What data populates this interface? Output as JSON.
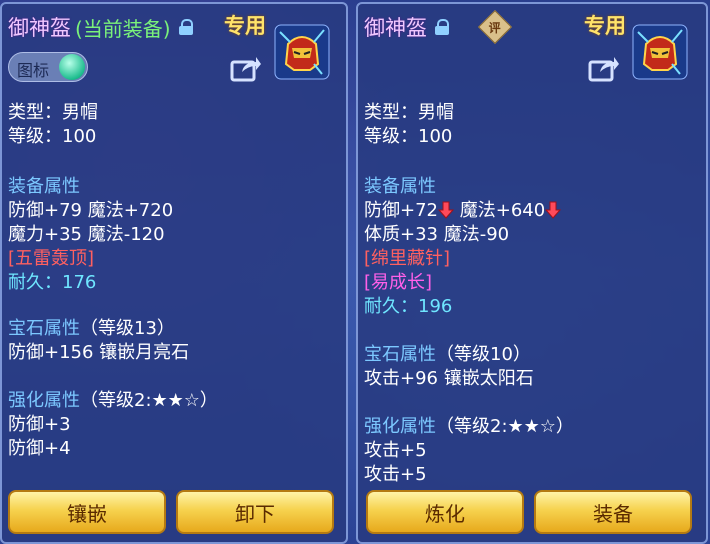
{
  "left": {
    "title": "御神盔",
    "equipped_tag": "(当前装备)",
    "exclusive": "专用",
    "toggle_label": "图标",
    "type": "类型：男帽",
    "level": "等级：100",
    "equip_section": "装备属性",
    "attr1": "防御+79 魔法+720",
    "attr2": "魔力+35 魔法-120",
    "special": "[五雷轰顶]",
    "durability": "耐久：176",
    "gem_section": "宝石属性",
    "gem_level": "（等级13）",
    "gem_attr": "防御+156 镶嵌月亮石",
    "enhance_section": "强化属性",
    "enhance_level": "（等级2:★★☆）",
    "enhance1": "防御+3",
    "enhance2": "防御+4",
    "button1": "镶嵌",
    "button2": "卸下"
  },
  "right": {
    "title": "御神盔",
    "rated_badge": "评",
    "exclusive": "专用",
    "type": "类型：男帽",
    "level": "等级：100",
    "equip_section": "装备属性",
    "attr1a": "防御+72",
    "attr1b": "魔法+640",
    "attr2": "体质+33 魔法-90",
    "special1": "[绵里藏针]",
    "special2": "[易成长]",
    "durability": "耐久：196",
    "gem_section": "宝石属性",
    "gem_level": "（等级10）",
    "gem_attr": "攻击+96 镶嵌太阳石",
    "enhance_section": "强化属性",
    "enhance_level": "（等级2:★★☆）",
    "enhance1": "攻击+5",
    "enhance2": "攻击+5",
    "button1": "炼化",
    "button2": "装备"
  },
  "icons": {
    "lock": "lock-icon",
    "share": "share-icon",
    "down_arrow": "arrow-down-icon",
    "helmet": "helmet-item-icon"
  },
  "colors": {
    "section": "#7cc8ff",
    "special_red": "#ff6060",
    "special_magenta": "#ff60e8",
    "durability": "#6fe6ff",
    "exclusive": "#ffe36a",
    "button": "#f6d24e"
  }
}
